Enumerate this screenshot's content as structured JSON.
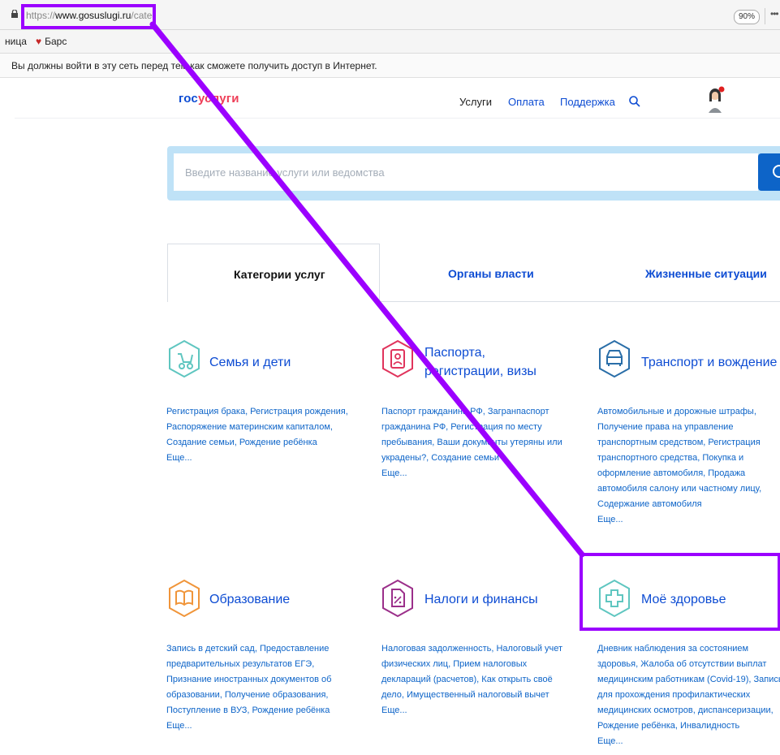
{
  "browser": {
    "url_scheme": "https://",
    "url_host": "www.gosuslugi.ru",
    "url_path": "/category",
    "zoom": "90%",
    "bookmarks": [
      "ница",
      "Барс"
    ],
    "notice": "Вы должны войти в эту сеть перед тем как сможете получить доступ в Интернет."
  },
  "header": {
    "logo_part1": "гос",
    "logo_part2": "услуги",
    "nav": [
      "Услуги",
      "Оплата",
      "Поддержка"
    ]
  },
  "search": {
    "placeholder": "Введите название услуги или ведомства"
  },
  "tabs": [
    {
      "label": "Категории услуг",
      "active": true
    },
    {
      "label": "Органы власти",
      "active": false
    },
    {
      "label": "Жизненные ситуации",
      "active": false
    }
  ],
  "categories": [
    {
      "title": "Семья и дети",
      "icon": "stroller-icon",
      "color": "#5fc6c0",
      "links": "Регистрация брака, Регистрация рождения, Распоряжение материнским капиталом, Создание семьи, Рождение ребёнка",
      "more": "Еще..."
    },
    {
      "title_line1": "Паспорта,",
      "title_line2": "регистрации, визы",
      "icon": "passport-icon",
      "color": "#e0345c",
      "links": "Паспорт гражданина РФ, Загранпаспорт гражданина РФ, Регистрация по месту пребывания, Ваши документы утеряны или украдены?, Создание семьи",
      "more": "Еще..."
    },
    {
      "title": "Транспорт и вождение",
      "icon": "car-icon",
      "color": "#2a6ea8",
      "links": "Автомобильные и дорожные штрафы, Получение права на управление транспортным средством, Регистрация транспортного средства, Покупка и оформление автомобиля, Продажа автомобиля салону или частному лицу, Содержание автомобиля",
      "more": "Еще..."
    },
    {
      "title": "Образование",
      "icon": "book-icon",
      "color": "#f0953a",
      "links": "Запись в детский сад, Предоставление предварительных результатов ЕГЭ, Признание иностранных документов об образовании, Получение образования, Поступление в ВУЗ, Рождение ребёнка",
      "more": "Еще..."
    },
    {
      "title": "Налоги и финансы",
      "icon": "tax-document-icon",
      "color": "#9b2f8a",
      "links": "Налоговая задолженность, Налоговый учет физических лиц, Прием налоговых деклараций (расчетов), Как открыть своё дело, Имущественный налоговый вычет",
      "more": "Еще..."
    },
    {
      "title": "Моё здоровье",
      "icon": "medical-cross-icon",
      "color": "#5fc6c0",
      "links": "Дневник наблюдения за состоянием здоровья, Жалоба об отсутствии выплат медицинским работникам (Covid-19), Запись для прохождения профилактических медицинских осмотров, диспансеризации, Рождение ребёнка, Инвалидность",
      "more": "Еще..."
    }
  ],
  "colors": {
    "brand_blue": "#0d4cd3",
    "brand_red": "#ee3f58",
    "search_band": "#bfe2f7",
    "annotation": "#9b00ff"
  }
}
